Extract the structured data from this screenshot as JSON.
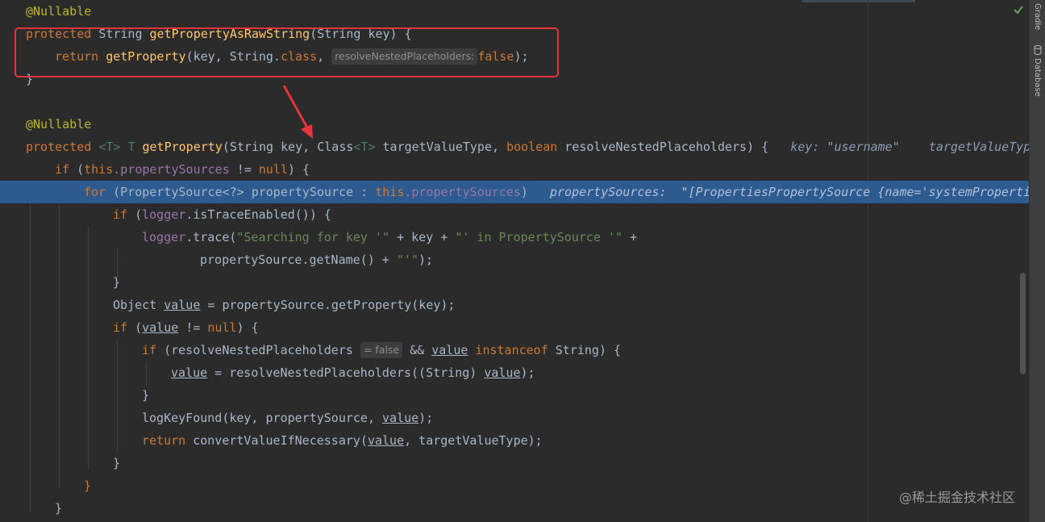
{
  "code": {
    "l1": {
      "ann": "@Nullable"
    },
    "l2": {
      "kw": "protected",
      "type": "String",
      "fn": "getPropertyAsRawString",
      "params": "(String key) {"
    },
    "l3": {
      "kw": "return",
      "fn": "getProperty",
      "args": "(key, String.",
      "cls": "class",
      "comma": ", ",
      "hint": "resolveNestedPlaceholders:",
      "val": "false",
      "end": ");"
    },
    "l4": {
      "text": "}"
    },
    "l6": {
      "ann": "@Nullable"
    },
    "l7": {
      "kw": "protected",
      "tp1": "<T>",
      "tp2": "T",
      "fn": "getProperty",
      "p1": "(String key, Class",
      "tp3": "<T>",
      "p2": " targetValueType, ",
      "kw2": "boolean",
      "p3": " resolveNestedPlaceholders) {",
      "dbg": "key: \"username\"    targetValueType"
    },
    "l8": {
      "kw": "if",
      "p1": " (",
      "this": "this",
      "fld": ".propertySources",
      "p2": " != ",
      "null": "null",
      "p3": ") {"
    },
    "l9": {
      "kw": "for",
      "p1": " (PropertySource<?> propertySource : ",
      "this": "this",
      "fld": ".propertySources",
      "p2": ")",
      "dbg": "propertySources:  \"[PropertiesPropertySource {name='systemPropertie"
    },
    "l10": {
      "kw": "if",
      "p1": " (",
      "fld": "logger",
      "p2": ".isTraceEnabled()) {"
    },
    "l11": {
      "fld": "logger",
      "p1": ".trace(",
      "s1": "\"Searching for key '\"",
      "p2": " + key + ",
      "s2": "\"' in PropertySource '\"",
      "p3": " +"
    },
    "l12": {
      "p1": "propertySource.getName() + ",
      "s1": "\"'\"",
      "p2": ");"
    },
    "l13": {
      "text": "}"
    },
    "l14": {
      "p1": "Object ",
      "v": "value",
      "p2": " = propertySource.getProperty(key);"
    },
    "l15": {
      "kw": "if",
      "p1": " (",
      "v": "value",
      "p2": " != ",
      "null": "null",
      "p3": ") {"
    },
    "l16": {
      "kw": "if",
      "p1": " (resolveNestedPlaceholders",
      "hint": "= false",
      "p2": " && ",
      "v": "value",
      "kw2": " instanceof",
      "p3": " String) {"
    },
    "l17": {
      "v": "value",
      "p1": " = resolveNestedPlaceholders((String) ",
      "v2": "value",
      "p2": ");"
    },
    "l18": {
      "text": "}"
    },
    "l19": {
      "p1": "logKeyFound(key, propertySource, ",
      "v": "value",
      "p2": ");"
    },
    "l20": {
      "kw": "return",
      "p1": " convertValueIfNecessary(",
      "v": "value",
      "p2": ", targetValueType);"
    },
    "l21": {
      "text": "}"
    },
    "l22": {
      "text": "}"
    },
    "l23": {
      "text": "}"
    }
  },
  "sidebar": {
    "gradle": "Gradle",
    "database": "Database"
  },
  "watermark": "@稀土掘金技术社区",
  "colors": {
    "keyword": "#cc7832",
    "annotation": "#bbb529",
    "method": "#ffc66d",
    "field": "#9876aa",
    "string": "#6a8759",
    "execution_line": "#2d5a8f",
    "highlight_box": "#e5343b"
  }
}
